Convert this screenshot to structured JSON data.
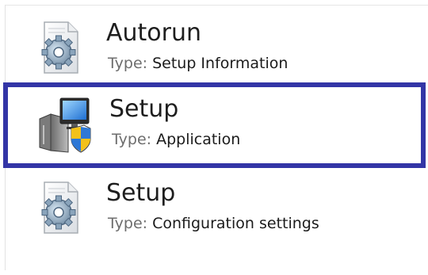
{
  "items": [
    {
      "name": "Autorun",
      "type_label": "Type:",
      "type_value": "Setup Information",
      "icon": "settings-file-icon",
      "selected": false
    },
    {
      "name": "Setup",
      "type_label": "Type:",
      "type_value": "Application",
      "icon": "installer-app-icon",
      "selected": true
    },
    {
      "name": "Setup",
      "type_label": "Type:",
      "type_value": "Configuration settings",
      "icon": "settings-file-icon",
      "selected": false
    }
  ],
  "colors": {
    "selection_border": "#3335a6",
    "type_label": "#6d6d6d",
    "name_text": "#1e1e1e"
  }
}
